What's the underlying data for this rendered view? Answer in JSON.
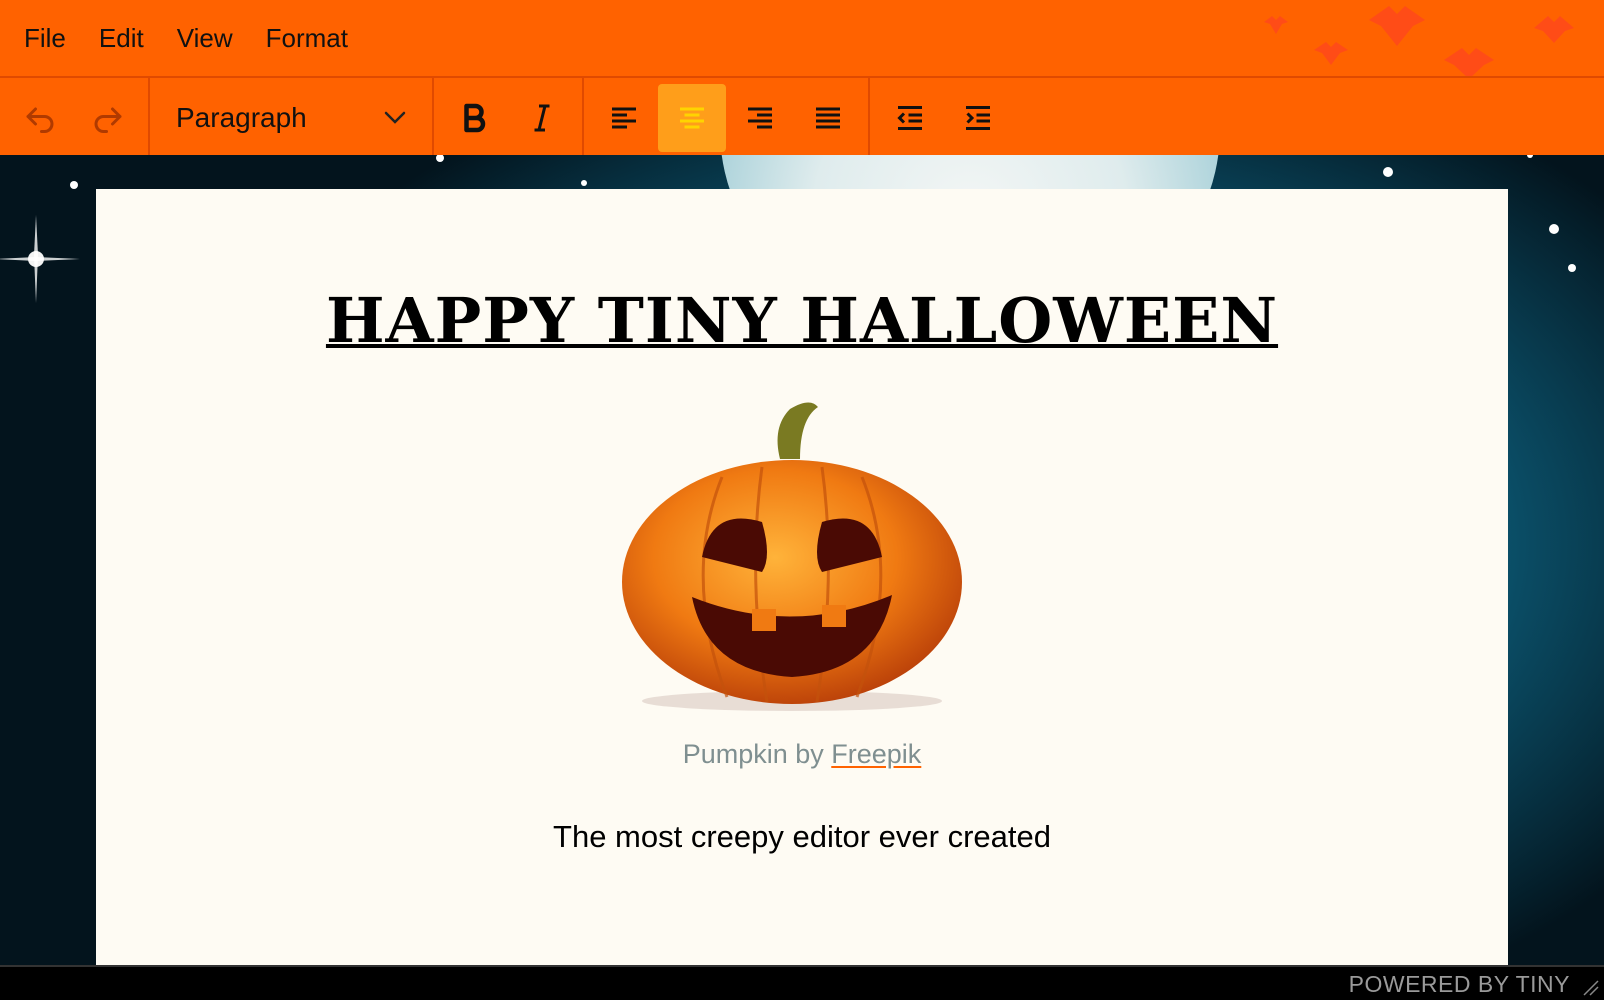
{
  "menubar": {
    "items": [
      {
        "label": "File"
      },
      {
        "label": "Edit"
      },
      {
        "label": "View"
      },
      {
        "label": "Format"
      }
    ]
  },
  "toolbar": {
    "undo_icon": "undo-icon",
    "redo_icon": "redo-icon",
    "block_format": "Paragraph",
    "bold_icon": "bold-icon",
    "italic_icon": "italic-icon",
    "align_left_icon": "align-left-icon",
    "align_center_icon": "align-center-icon",
    "align_center_active": true,
    "align_right_icon": "align-right-icon",
    "justify_icon": "justify-icon",
    "outdent_icon": "outdent-icon",
    "indent_icon": "indent-icon"
  },
  "content": {
    "heading": "HAPPY TINY HALLOWEEN",
    "caption_prefix": "Pumpkin by ",
    "caption_link": "Freepik",
    "tagline": "The most creepy editor ever created"
  },
  "statusbar": {
    "branding": "POWERED BY TINY"
  },
  "colors": {
    "accent": "#ff6200",
    "active_button": "#ff9e1a",
    "page": "#fefbf3"
  }
}
